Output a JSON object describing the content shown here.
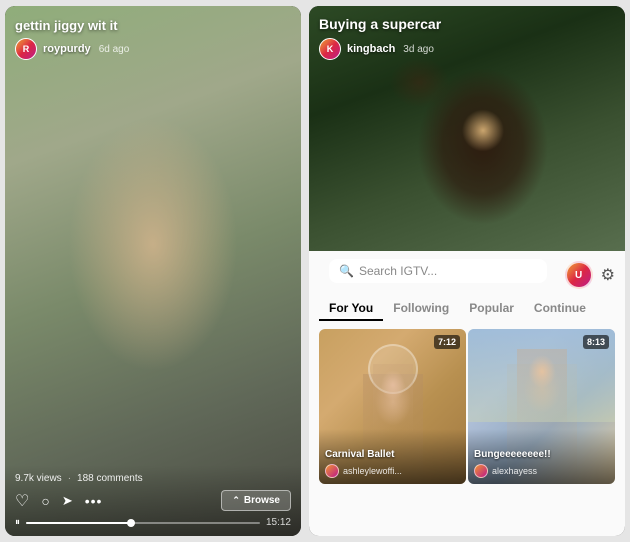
{
  "left": {
    "title": "gettin jiggy wit it",
    "username": "roypurdy",
    "time_ago": "6d ago",
    "views": "9.7k views",
    "comments": "188 comments",
    "duration": "15:12",
    "browse_label": "Browse",
    "pause_icon": "⏸",
    "heart_icon": "♡",
    "comment_icon": "💬",
    "share_icon": "➤",
    "more_icon": "···"
  },
  "right": {
    "title": "Buying a supercar",
    "username": "kingbach",
    "time_ago": "3d ago",
    "search_placeholder": "Search IGTV...",
    "tabs": [
      {
        "label": "For You",
        "active": true
      },
      {
        "label": "Following",
        "active": false
      },
      {
        "label": "Popular",
        "active": false
      },
      {
        "label": "Continue",
        "active": false
      }
    ],
    "cards": [
      {
        "title": "Carnival Ballet",
        "username": "ashleylewoffi...",
        "duration": "7:12"
      },
      {
        "title": "Bungeeeeeeee!!",
        "username": "alexhayess",
        "duration": "8:13"
      }
    ]
  }
}
